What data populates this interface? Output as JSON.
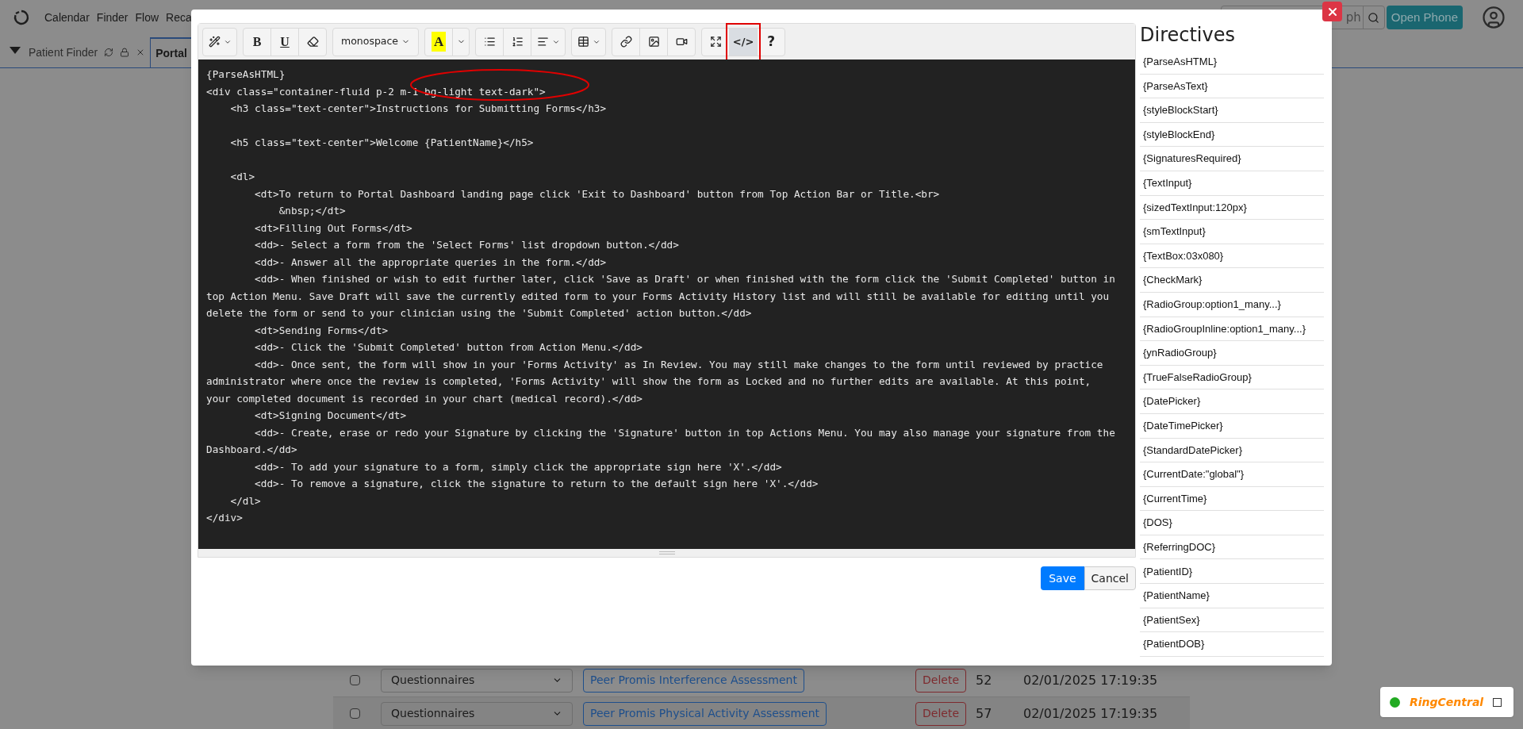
{
  "nav": {
    "items": [
      "Calendar",
      "Finder",
      "Flow",
      "Reca"
    ],
    "search_placeholder": "ph",
    "open_phone": "Open Phone"
  },
  "tabs": [
    {
      "label": "Patient Finder",
      "selected": false
    },
    {
      "label": "Portal",
      "selected": true
    }
  ],
  "table_rows": [
    {
      "checked": false,
      "category": "Questionnaires",
      "form": "Peer Promis Interference Assessment",
      "action": "Delete",
      "id": "52",
      "date": "02/01/2025 17:19:35"
    },
    {
      "checked": false,
      "category": "Questionnaires",
      "form": "Peer Promis Physical Activity Assessment",
      "action": "Delete",
      "id": "57",
      "date": "02/01/2025 17:19:35"
    }
  ],
  "editor": {
    "toolbar": [
      [
        {
          "kind": "magic",
          "selected": false
        }
      ],
      [
        {
          "kind": "bold",
          "label": "B",
          "selected": false
        },
        {
          "kind": "underline",
          "label": "U",
          "selected": false
        },
        {
          "kind": "eraser",
          "selected": false
        }
      ],
      [
        {
          "kind": "font",
          "label": "monospace",
          "selected": false
        }
      ],
      [
        {
          "kind": "highlight",
          "label": "A",
          "selected": false
        },
        {
          "kind": "caret",
          "selected": false
        }
      ],
      [
        {
          "kind": "bullets",
          "selected": false
        },
        {
          "kind": "numbers",
          "selected": false
        },
        {
          "kind": "align",
          "selected": false
        }
      ],
      [
        {
          "kind": "table",
          "selected": false
        }
      ],
      [
        {
          "kind": "link",
          "selected": false
        },
        {
          "kind": "picture",
          "selected": false
        },
        {
          "kind": "video",
          "selected": false
        }
      ],
      [
        {
          "kind": "fullscreen",
          "selected": false
        },
        {
          "kind": "code",
          "label": "</>",
          "selected": true
        },
        {
          "kind": "help",
          "label": "?",
          "selected": false
        }
      ]
    ],
    "code_lines": [
      {
        "kind": "code",
        "text": "{ParseAsHTML}"
      },
      {
        "kind": "code",
        "text": "<div class=\"container-fluid p-2 m-1 bg-light text-dark\">"
      },
      {
        "kind": "code",
        "text": "    <h3 class=\"text-center\">Instructions for Submitting Forms</h3>"
      },
      {
        "kind": "blank"
      },
      {
        "kind": "code",
        "text": "    <h5 class=\"text-center\">Welcome {PatientName}</h5>"
      },
      {
        "kind": "blank"
      },
      {
        "kind": "code",
        "text": "    <dl>"
      },
      {
        "kind": "code",
        "text": "        <dt>To return to Portal Dashboard landing page click 'Exit to Dashboard' button from Top Action Bar or Title.<br>"
      },
      {
        "kind": "code",
        "text": "            &nbsp;</dt>"
      },
      {
        "kind": "code",
        "text": "        <dt>Filling Out Forms</dt>"
      },
      {
        "kind": "code",
        "text": "        <dd>- Select a form from the 'Select Forms' list dropdown button.</dd>"
      },
      {
        "kind": "code",
        "text": "        <dd>- Answer all the appropriate queries in the form.</dd>"
      },
      {
        "kind": "code",
        "text": "        <dd>- When finished or wish to edit further later, click 'Save as Draft' or when finished with the form click the 'Submit Completed' button in"
      },
      {
        "kind": "code",
        "text": "top Action Menu. Save Draft will save the currently edited form to your Forms Activity History list and will still be available for editing until you"
      },
      {
        "kind": "code",
        "text": "delete the form or send to your clinician using the 'Submit Completed' action button.</dd>"
      },
      {
        "kind": "code",
        "text": "        <dt>Sending Forms</dt>"
      },
      {
        "kind": "code",
        "text": "        <dd>- Click the 'Submit Completed' button from Action Menu.</dd>"
      },
      {
        "kind": "code",
        "text": "        <dd>- Once sent, the form will show in your 'Forms Activity' as In Review. You may still make changes to the form until reviewed by practice"
      },
      {
        "kind": "code",
        "text": "administrator where once the review is completed, 'Forms Activity' will show the form as Locked and no further edits are available. At this point,"
      },
      {
        "kind": "code",
        "text": "your completed document is recorded in your chart (medical record).</dd>"
      },
      {
        "kind": "code",
        "text": "        <dt>Signing Document</dt>"
      },
      {
        "kind": "code",
        "text": "        <dd>- Create, erase or redo your Signature by clicking the 'Signature' button in top Actions Menu. You may also manage your signature from the"
      },
      {
        "kind": "code",
        "text": "Dashboard.</dd>"
      },
      {
        "kind": "code",
        "text": "        <dd>- To add your signature to a form, simply click the appropriate sign here 'X'.</dd>"
      },
      {
        "kind": "code",
        "text": "        <dd>- To remove a signature, click the signature to return to the default sign here 'X'.</dd>"
      },
      {
        "kind": "code",
        "text": "    </dl>"
      },
      {
        "kind": "code",
        "text": "</div>"
      }
    ],
    "save": "Save",
    "cancel": "Cancel"
  },
  "directives": {
    "title": "Directives",
    "items": [
      "{ParseAsHTML}",
      "{ParseAsText}",
      "{styleBlockStart}",
      "{styleBlockEnd}",
      "{SignaturesRequired}",
      "{TextInput}",
      "{sizedTextInput:120px}",
      "{smTextInput}",
      "{TextBox:03x080}",
      "{CheckMark}",
      "{RadioGroup:option1_many...}",
      "{RadioGroupInline:option1_many...}",
      "{ynRadioGroup}",
      "{TrueFalseRadioGroup}",
      "{DatePicker}",
      "{DateTimePicker}",
      "{StandardDatePicker}",
      "{CurrentDate:\"global\"}",
      "{CurrentTime}",
      "{DOS}",
      "{ReferringDOC}",
      "{PatientID}",
      "{PatientName}",
      "{PatientSex}",
      "{PatientDOB}"
    ]
  },
  "ringcentral": {
    "label": "RingCentral",
    "online": true
  }
}
